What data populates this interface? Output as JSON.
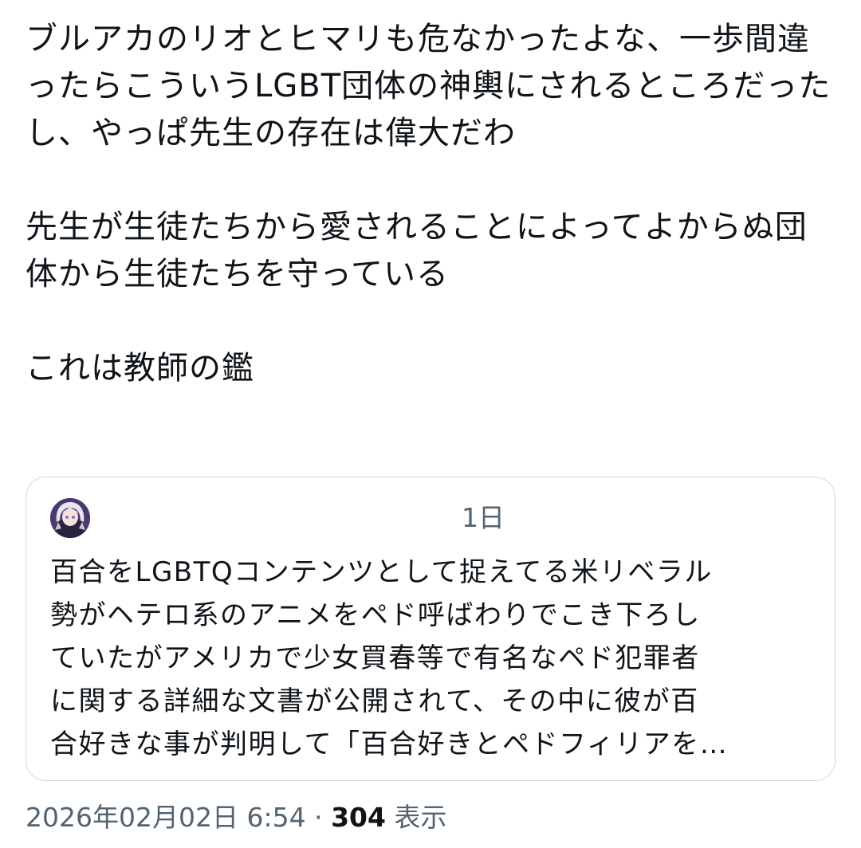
{
  "post": {
    "paragraphs": [
      "ブルアカのリオとヒマリも危なかったよな、一歩間違ったらこういうLGBT団体の神輿にされるところだったし、やっぱ先生の存在は偉大だわ",
      "先生が生徒たちから愛されることによってよからぬ団体から生徒たちを守っている",
      "これは教師の鑑"
    ]
  },
  "quote": {
    "time": "1日",
    "lines": [
      "百合をLGBTQコンテンツとして捉えてる米リベラル",
      "勢がヘテロ系のアニメをペド呼ばわりでこき下ろし",
      "ていたがアメリカで少女買春等で有名なペド犯罪者",
      "に関する詳細な文書が公開されて、その中に彼が百",
      "合好きな事が判明して「百合好きとペドフィリアを…"
    ]
  },
  "meta": {
    "timestamp": "2026年02月02日 6:54",
    "separator": "·",
    "views_count": "304",
    "views_label": "表示"
  },
  "colors": {
    "text": "#0f1419",
    "secondary": "#536471",
    "border": "#cfd9de"
  },
  "icons": {
    "avatar": "avatar-image"
  }
}
